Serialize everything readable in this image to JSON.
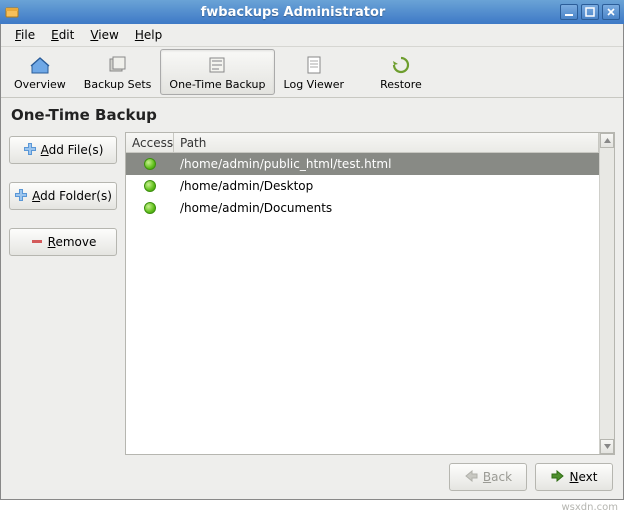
{
  "titlebar": {
    "title": "fwbackups Administrator"
  },
  "menubar": {
    "file": "File",
    "edit": "Edit",
    "view": "View",
    "help": "Help"
  },
  "toolbar": {
    "overview": "Overview",
    "backup_sets": "Backup Sets",
    "one_time_backup": "One-Time Backup",
    "log_viewer": "Log Viewer",
    "restore": "Restore"
  },
  "page": {
    "title": "One-Time Backup"
  },
  "left_actions": {
    "add_files": {
      "pre": "",
      "u": "A",
      "post": "dd File(s)"
    },
    "add_folders": {
      "pre": "",
      "u": "A",
      "post": "dd Folder(s)"
    },
    "remove": {
      "pre": "",
      "u": "R",
      "post": "emove"
    }
  },
  "columns": {
    "access": "Access",
    "path": "Path"
  },
  "rows": [
    {
      "path": "/home/admin/public_html/test.html",
      "selected": true
    },
    {
      "path": "/home/admin/Desktop",
      "selected": false
    },
    {
      "path": "/home/admin/Documents",
      "selected": false
    }
  ],
  "nav": {
    "back": {
      "u": "B",
      "post": "ack"
    },
    "next": {
      "u": "N",
      "post": "ext"
    }
  },
  "watermark": "wsxdn.com"
}
